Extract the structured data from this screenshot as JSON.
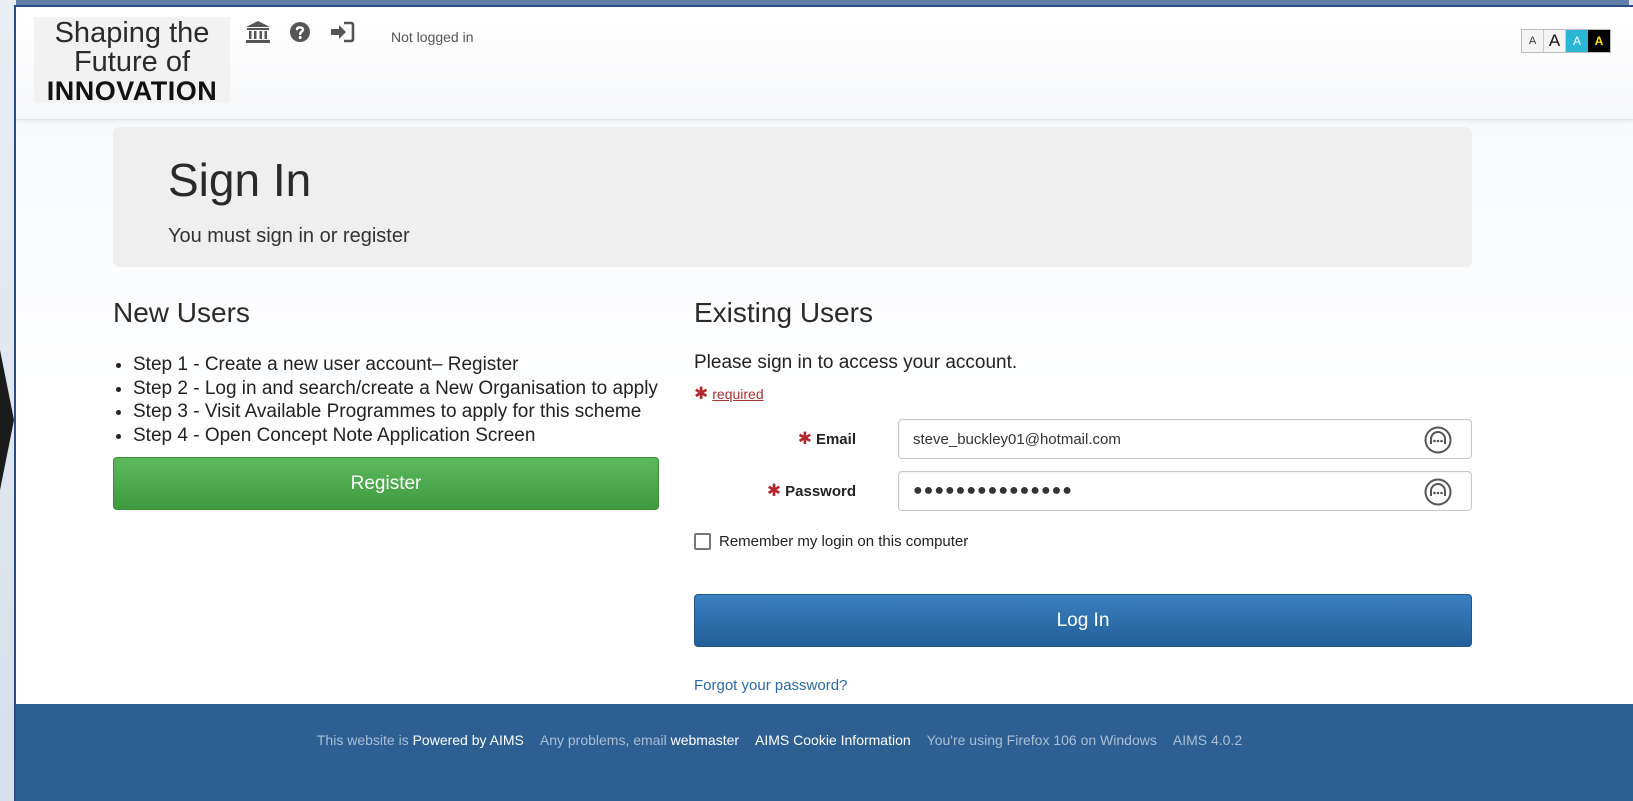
{
  "logo": {
    "line1": "Shaping the",
    "line2": "Future of",
    "line3": "INNOVATION"
  },
  "header": {
    "nav_icons": [
      "bank-icon",
      "question-circle-icon",
      "sign-in-icon"
    ],
    "login_status": "Not logged in",
    "accessibility": {
      "small": "A",
      "large": "A",
      "cyan": "A",
      "yellow": "A"
    }
  },
  "jumbotron": {
    "title": "Sign In",
    "subtitle": "You must sign in or register"
  },
  "new_users": {
    "heading": "New Users",
    "steps": [
      "Step 1 - Create a new user account– Register",
      "Step 2 - Log in and search/create a New Organisation to apply",
      "Step 3 - Visit Available Programmes to apply for this scheme",
      "Step 4 - Open Concept Note Application Screen"
    ],
    "register_label": "Register"
  },
  "existing_users": {
    "heading": "Existing Users",
    "intro": "Please sign in to access your account.",
    "required_label": "required",
    "required_marker": "✱",
    "email_label": "Email",
    "email_value": "steve_buckley01@hotmail.com",
    "password_label": "Password",
    "password_value": "●●●●●●●●●●●●●●●",
    "remember_label": "Remember my login on this computer",
    "remember_checked": false,
    "login_label": "Log In",
    "forgot_label": "Forgot your password?"
  },
  "footer": {
    "powered_prefix": "This website is",
    "powered_link": "Powered by AIMS",
    "problems_prefix": "Any problems, email",
    "problems_link": "webmaster",
    "cookie_link": "AIMS Cookie Information",
    "browser_info": "You're using Firefox 106 on Windows",
    "version": "AIMS 4.0.2"
  },
  "colors": {
    "register_green": "#4cae4c",
    "login_blue": "#2a6aa8",
    "footer_blue": "#2e5f93",
    "required_red": "#b5272d",
    "link_blue": "#2a6aaa"
  }
}
